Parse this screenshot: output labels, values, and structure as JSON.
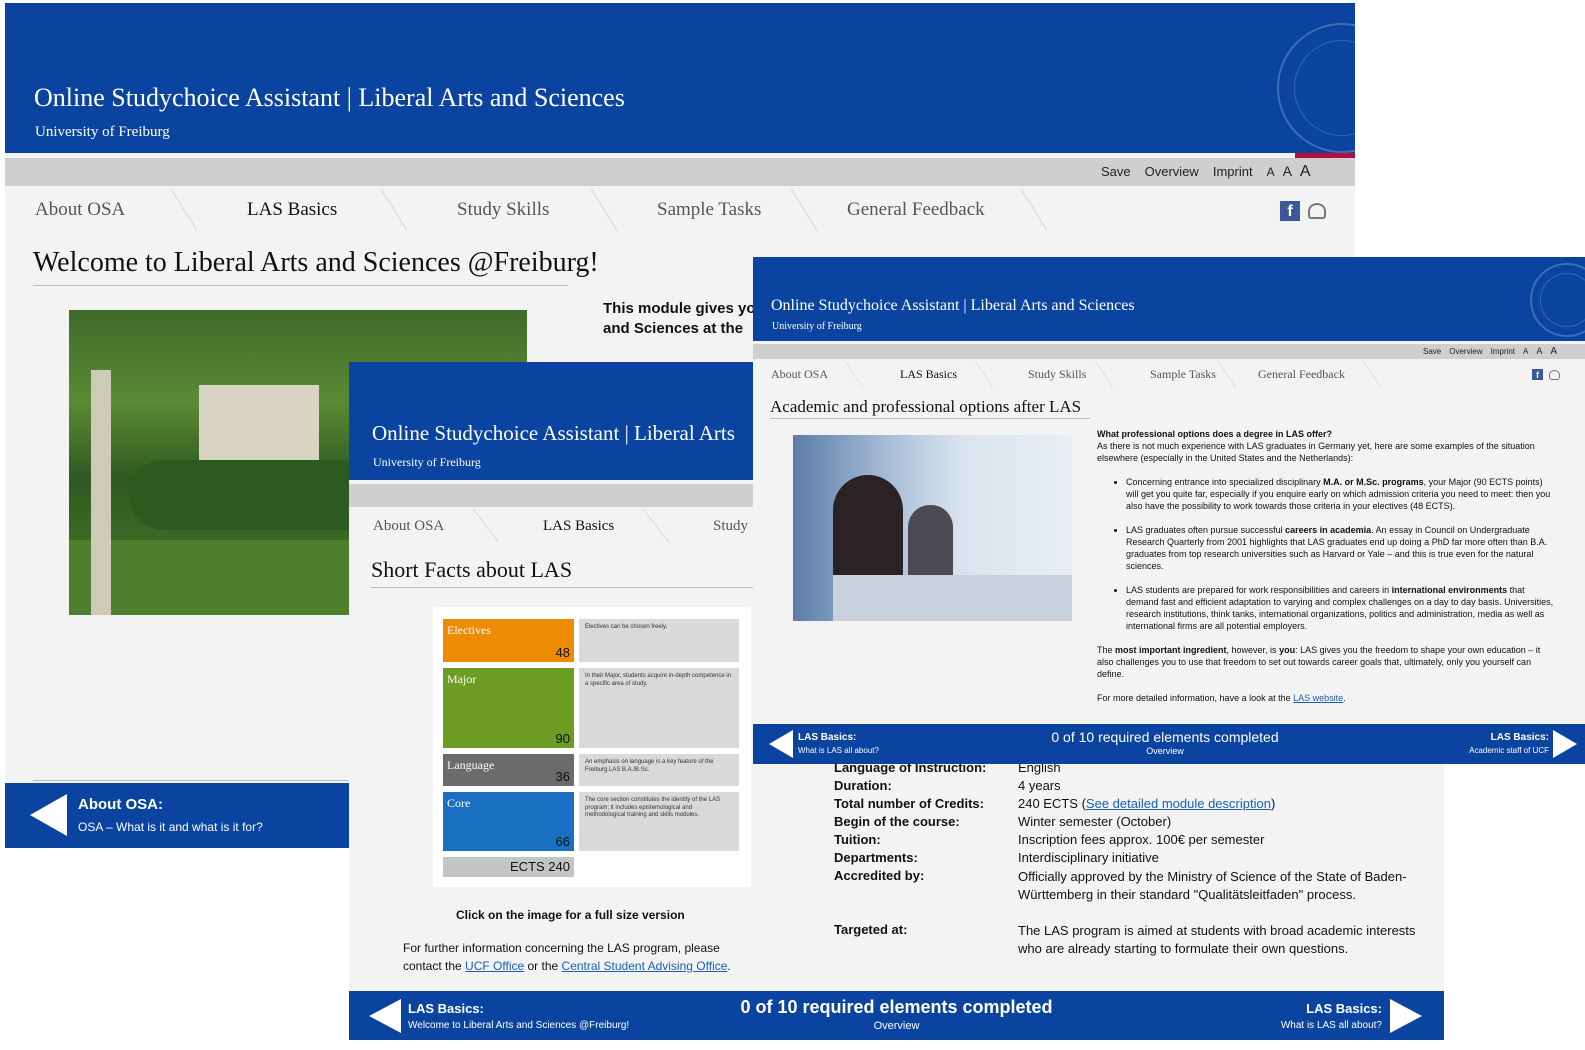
{
  "common": {
    "app_title": "Online Studychoice Assistant | Liberal Arts and Sciences",
    "app_title_cut": "Online Studychoice Assistant | Liberal Arts",
    "subtitle": "University of Freiburg",
    "utility": [
      "Save",
      "Overview",
      "Imprint",
      "A",
      "A",
      "A"
    ],
    "tabs": [
      "About OSA",
      "LAS Basics",
      "Study Skills",
      "Sample Tasks",
      "General Feedback"
    ],
    "fb_label": "f",
    "progress": "0 of 10 required elements completed",
    "overview": "Overview",
    "colors": {
      "header_blue": "#0a44a0",
      "grey_bar": "#cfcfcf",
      "link": "#1a5fb4"
    }
  },
  "win1": {
    "page_title": "Welcome to Liberal Arts and Sciences @Freiburg!",
    "intro_line1": "This module gives yo",
    "intro_line2": "and Sciences at the",
    "footer_prev_title": "About OSA:",
    "footer_prev_sub": "OSA – What is it and what is it for?"
  },
  "win2": {
    "page_title": "Short Facts about LAS",
    "tabs_visible": [
      "About OSA",
      "LAS Basics",
      "Study"
    ],
    "ects": [
      {
        "label": "Electives",
        "value": "48",
        "desc": "Electives can be chosen freely.",
        "color": "#ef8a05"
      },
      {
        "label": "Major",
        "value": "90",
        "desc": "In their Major, students acquire in-depth competence in a specific area of study.",
        "color": "#6d9c22"
      },
      {
        "label": "Language",
        "value": "36",
        "desc": "An emphasis on language is a key feature of the Freiburg LAS B.A./B.Sc.",
        "color": "#6b6b6b"
      },
      {
        "label": "Core",
        "value": "66",
        "desc": "The core section constitutes the identity of the LAS program; it includes epistemological and methodological training and skills modules.",
        "color": "#1a6fc2"
      }
    ],
    "ects_total": "ECTS 240",
    "click_caption": "Click on the image for a full size version",
    "further_text_1": "For further information concerning the LAS program, please contact the ",
    "ucf_link": "UCF Office",
    "further_text_2": " or the ",
    "advising_link": "Central Student Advising Office",
    "further_text_3": ".",
    "facts": [
      {
        "key": "Language of Instruction:",
        "value": "English"
      },
      {
        "key": "Duration:",
        "value": "4 years"
      },
      {
        "key": "Total number of Credits:",
        "value_pre": "240 ECTS (",
        "value_link": "See detailed module description",
        "value_post": ")"
      },
      {
        "key": "Begin of the course:",
        "value": "Winter semester (October)"
      },
      {
        "key": "Tuition:",
        "value": " Inscription fees approx. 100€ per semester"
      },
      {
        "key": "Departments:",
        "value": "Interdisciplinary initiative"
      },
      {
        "key": "Accredited by:",
        "value": "Officially approved by the Ministry of Science of the State of Baden-Württemberg in their standard \"Qualitätsleitfaden\" process."
      },
      {
        "key": "Targeted at:",
        "value": "The LAS program is aimed at students with broad academic interests who are already starting to formulate their own questions."
      }
    ],
    "footer_prev_title": "LAS Basics:",
    "footer_prev_sub": "Welcome to Liberal Arts and Sciences @Freiburg!",
    "footer_next_title": "LAS Basics:",
    "footer_next_sub": "What is LAS all about?"
  },
  "win3": {
    "page_title": "Academic and professional options after LAS",
    "question": "What professional options does a degree in LAS offer?",
    "intro": "As there is not much experience with LAS graduates in Germany yet, here are some examples of the situation elsewhere (especially in the United States and the Netherlands):",
    "bullets": [
      {
        "pre": "Concerning entrance into specialized disciplinary ",
        "bold": "M.A. or M.Sc. programs",
        "post": ", your Major (90 ECTS points) will get you quite far, especially if you enquire early on which admission criteria you need to meet: then you also have the possibility to work towards those criteria in your electives (48 ECTS)."
      },
      {
        "pre": "LAS graduates often pursue successful ",
        "bold": "careers in academia",
        "post": ". An essay in Council on Undergraduate Research Quarterly from 2001 highlights that LAS graduates end up doing a PhD far more often than B.A. graduates from top research universities such as Harvard or Yale – and this is true even for the natural sciences."
      },
      {
        "pre": "LAS students are prepared for work responsibilities and careers in ",
        "bold": "international environments",
        "post": " that demand fast and efficient adaptation to varying and complex challenges on a day to day basis. Universities, research institutions, think tanks, international organizations, politics and administration, media as well as international firms are all potential employers."
      }
    ],
    "closing_pre": "The ",
    "closing_bold1": "most important ingredient",
    "closing_mid": ", however, is ",
    "closing_bold2": "you",
    "closing_post": ": LAS gives you the freedom to shape your own education – it also challenges you to use that freedom to set out towards career goals that, ultimately, only you yourself can define.",
    "more_pre": "For more detailed information, have a look at the ",
    "more_link": "LAS website",
    "more_post": ".",
    "footer_prev_title": "LAS Basics:",
    "footer_prev_sub": "What is LAS all about?",
    "footer_next_title": "LAS Basics:",
    "footer_next_sub": "Academic staff of UCF"
  }
}
